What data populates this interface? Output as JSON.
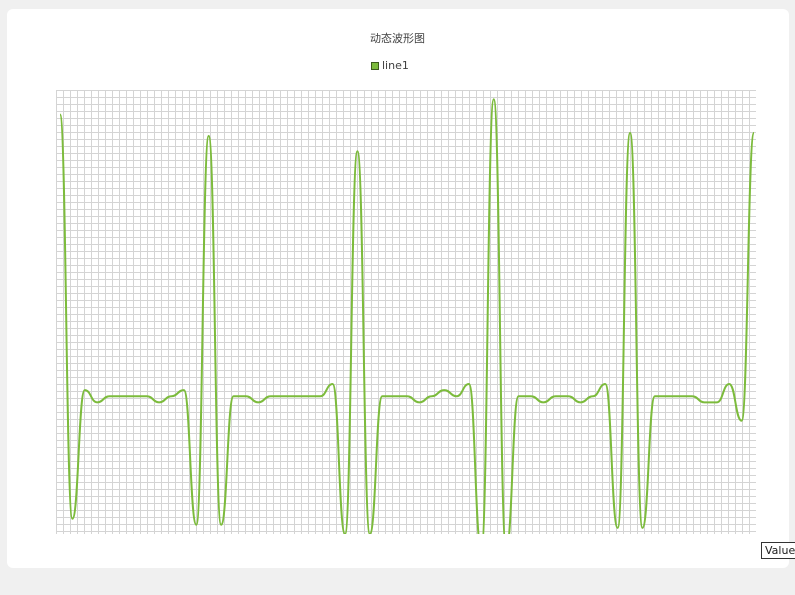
{
  "chart_data": {
    "type": "line",
    "title": "动态波形图",
    "legend_position": "top-center",
    "axis_label": "Values",
    "grid": true,
    "ylim": [
      -0.45,
      1.0
    ],
    "series": [
      {
        "name": "line1",
        "color": "#7cbb3c",
        "values": [
          0.92,
          -0.4,
          0.02,
          -0.02,
          0.0,
          0.0,
          0.0,
          0.0,
          -0.02,
          0.0,
          0.02,
          -0.42,
          0.85,
          -0.42,
          0.0,
          0.0,
          -0.02,
          0.0,
          0.0,
          0.0,
          0.0,
          0.0,
          0.04,
          -0.45,
          0.8,
          -0.45,
          0.0,
          0.0,
          0.0,
          -0.02,
          0.0,
          0.02,
          0.0,
          0.04,
          -0.5,
          0.97,
          -0.5,
          0.0,
          0.0,
          -0.02,
          0.0,
          0.0,
          -0.02,
          0.0,
          0.04,
          -0.43,
          0.86,
          -0.43,
          0.0,
          0.0,
          0.0,
          0.0,
          -0.02,
          -0.02,
          0.04,
          -0.08,
          0.86
        ]
      }
    ]
  }
}
